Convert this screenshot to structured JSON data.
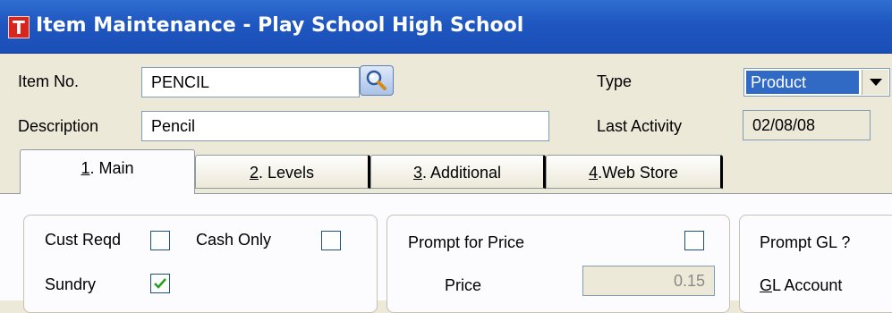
{
  "window": {
    "title": "Item Maintenance - Play School High School",
    "icon_letter": "T"
  },
  "header": {
    "item_no_label": "Item No.",
    "item_no_value": "PENCIL",
    "description_label": "Description",
    "description_value": "Pencil",
    "type_label": "Type",
    "type_value": "Product",
    "last_activity_label": "Last Activity",
    "last_activity_value": "02/08/08"
  },
  "tabs": [
    {
      "key": "1",
      "rest": ". Main"
    },
    {
      "key": "2",
      "rest": ". Levels"
    },
    {
      "key": "3",
      "rest": ". Additional"
    },
    {
      "key": "4",
      "rest": ".Web Store"
    }
  ],
  "main": {
    "cust_reqd_label": "Cust Reqd",
    "cust_reqd_checked": false,
    "cash_only_label": "Cash Only",
    "cash_only_checked": false,
    "sundry_label": "Sundry",
    "sundry_checked": true,
    "prompt_price_label": "Prompt for Price",
    "prompt_price_checked": false,
    "price_label": "Price",
    "price_value": "0.15",
    "prompt_gl_label": "Prompt GL ?",
    "gl_account_key": "G",
    "gl_account_rest": "L Account"
  },
  "colors": {
    "titlebar": "#1f56c0",
    "selection": "#316ac5",
    "checkmark": "#21a121",
    "app_icon": "#d9261c"
  }
}
